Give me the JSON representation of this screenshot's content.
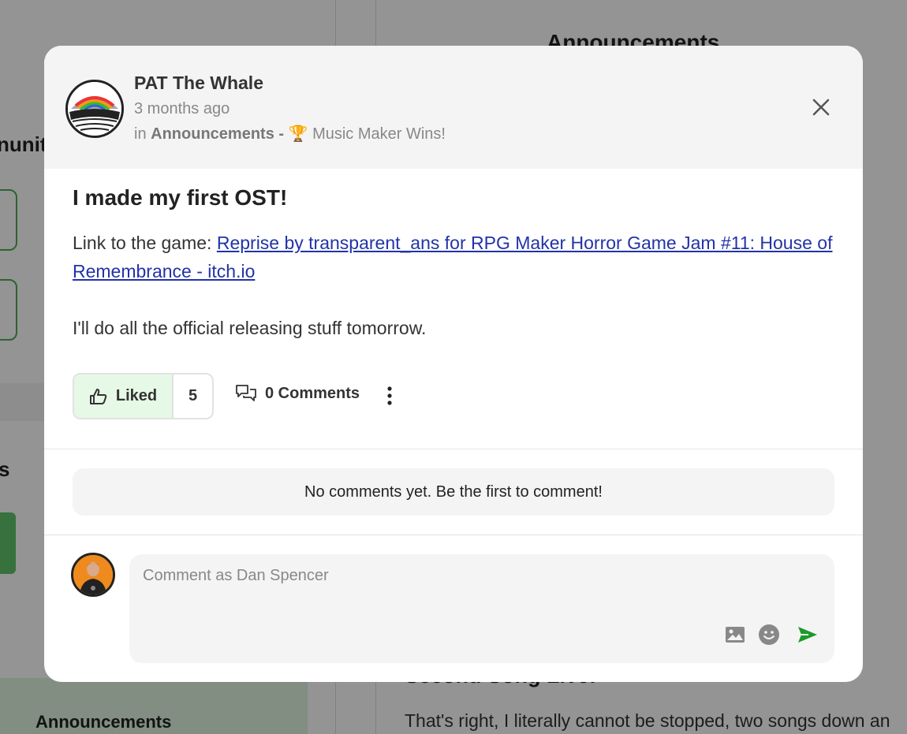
{
  "background": {
    "right_header": "Announcements",
    "left_partial": "nunit",
    "left_section": "s",
    "nav_active": "Announcements",
    "right_post_title": "Second Song Live!",
    "right_post_body": "That's right, I literally cannot be stopped, two songs down an"
  },
  "post": {
    "author": "PAT The Whale",
    "time": "3 months ago",
    "location_prefix": "in",
    "space": "Announcements",
    "separator": "-",
    "topic": "🏆 Music Maker Wins!",
    "title": "I made my first OST!",
    "link_intro": "Link to the game: ",
    "link_text": "Reprise by transparent_ans for RPG Maker Horror Game Jam #11: House of Remembrance - itch.io",
    "body_text": "I'll do all the official releasing stuff tomorrow."
  },
  "actions": {
    "like_label": "Liked",
    "like_count": "5",
    "comments_label": "0 Comments"
  },
  "comments": {
    "empty_message": "No comments yet. Be the first to comment!",
    "placeholder": "Comment as Dan Spencer"
  },
  "colors": {
    "accent_green": "#1a9a2a",
    "link_blue": "#2233a8",
    "liked_bg": "#e6f9e6"
  }
}
